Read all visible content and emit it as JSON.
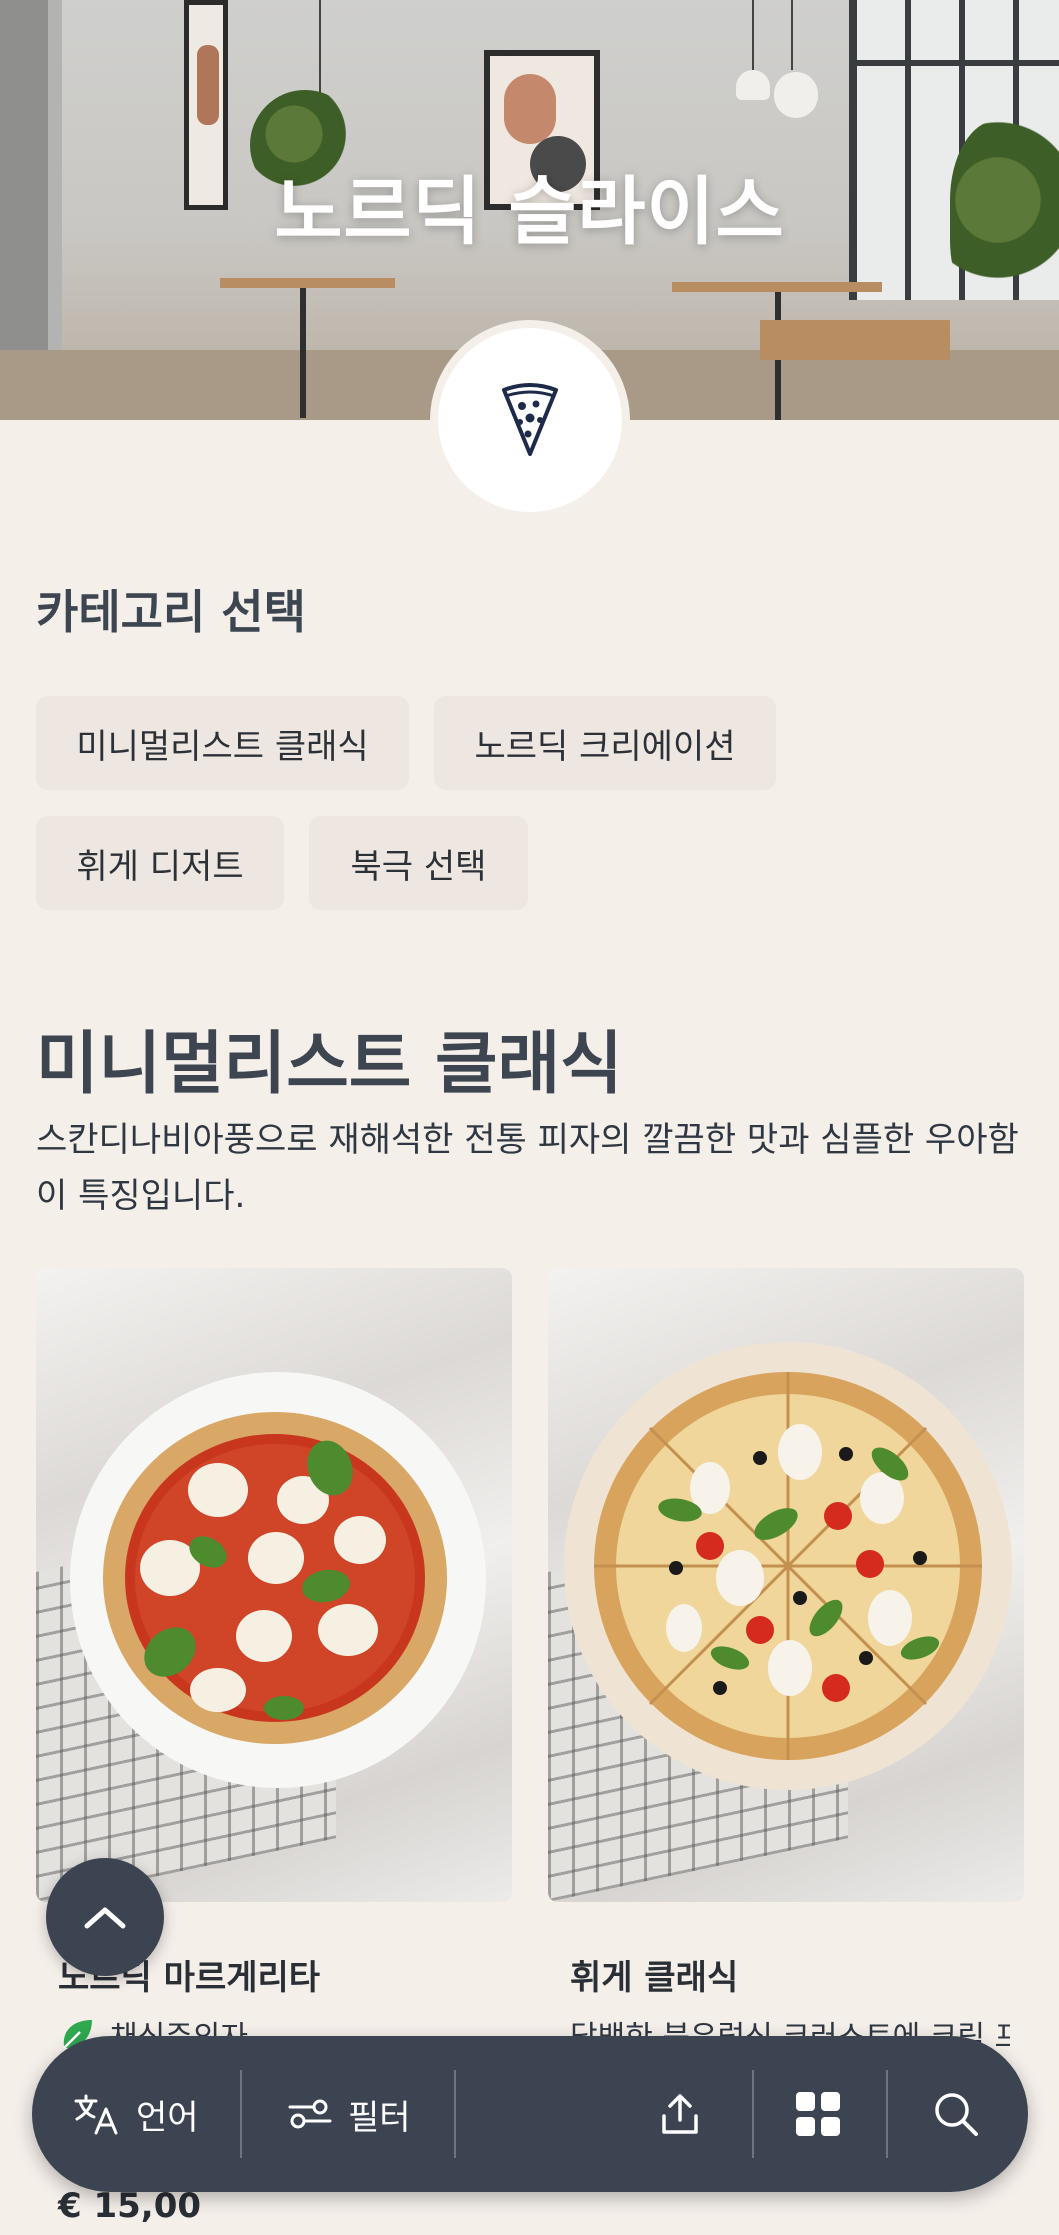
{
  "hero": {
    "title": "노르딕 슬라이스"
  },
  "categories": {
    "heading": "카테고리 선택",
    "chips": [
      "미니멀리스트 클래식",
      "노르딕 크리에이션",
      "휘게 디저트",
      "북극 선택"
    ]
  },
  "section": {
    "title": "미니멀리스트 클래식",
    "description": "스칸디나비아풍으로 재해석한 전통 피자의 깔끔한 맛과 심플한 우아함이 특징입니다."
  },
  "items": [
    {
      "name": "노르딕 마르게리타",
      "badge_text": "채식주의자",
      "price": "€ 15,00"
    },
    {
      "name": "휘게 클래식",
      "description": "담백한 북유럽식 크러스트에 크림 프"
    }
  ],
  "bottom_bar": {
    "language_label": "언어",
    "filter_label": "필터"
  },
  "icons": [
    "pizza-slice-logo-icon",
    "chevron-up-icon",
    "translate-icon",
    "filter-icon",
    "share-icon",
    "grid-icon",
    "search-icon",
    "leaf-icon"
  ],
  "colors": {
    "background": "#f5efea",
    "bar": "#3b4450",
    "chip": "#ede6e1",
    "text": "#3d4550"
  }
}
